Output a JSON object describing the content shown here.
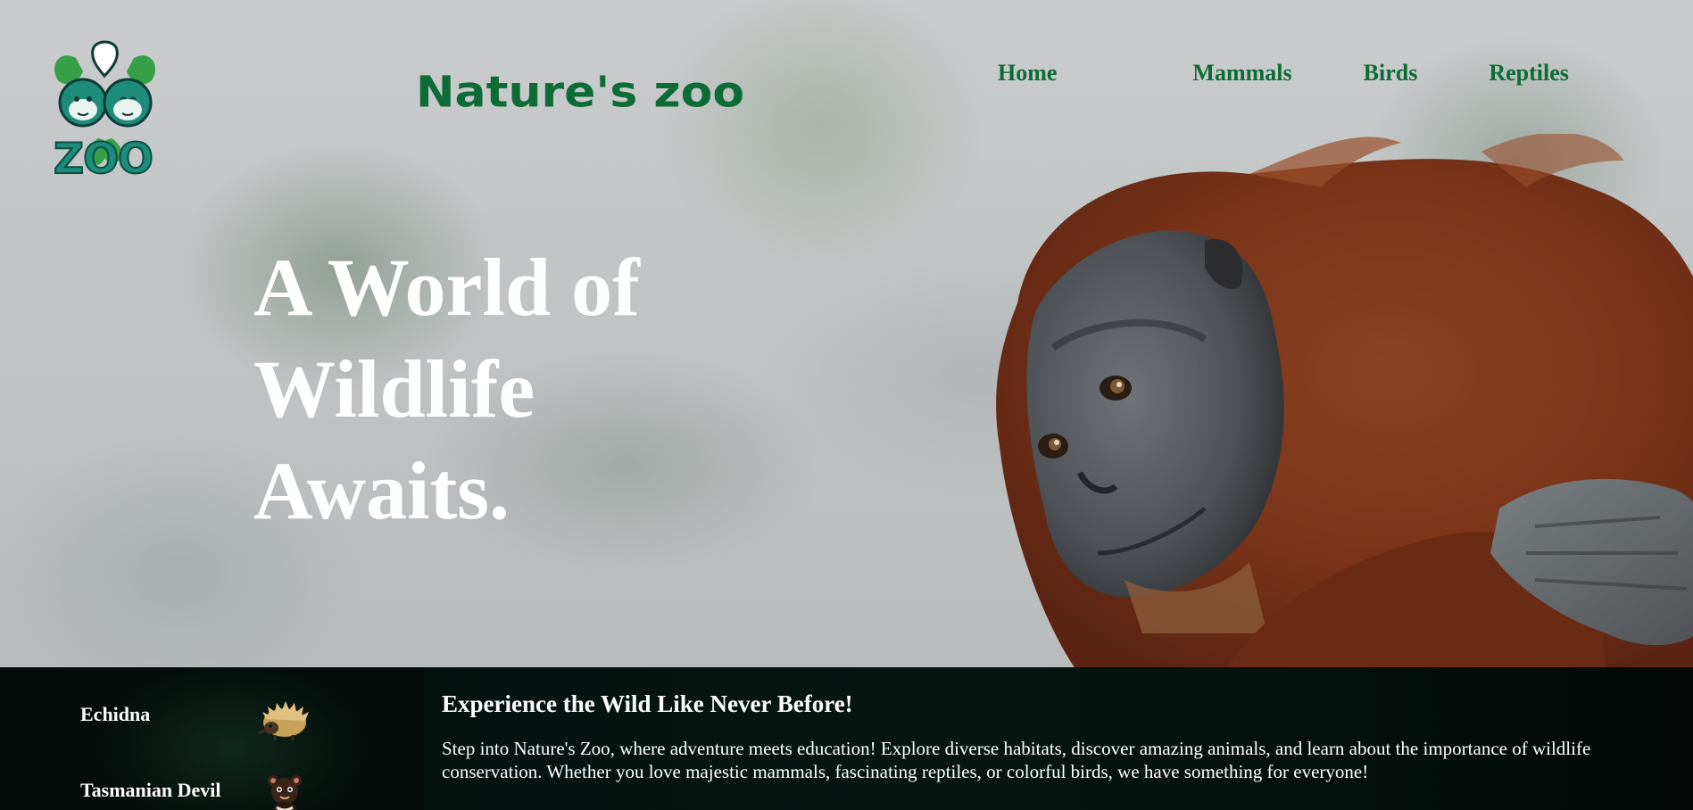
{
  "header": {
    "logo_text": "ZOO",
    "brand_title": "Nature's zoo",
    "nav": [
      {
        "label": "Home"
      },
      {
        "label": "Mammals"
      },
      {
        "label": "Birds"
      },
      {
        "label": "Reptiles"
      }
    ]
  },
  "hero": {
    "headline_line1": "A World of",
    "headline_line2": "Wildlife",
    "headline_line3": "Awaits.",
    "image_subject": "orangutan"
  },
  "sidebar": {
    "animals": [
      {
        "name": "Echidna",
        "icon": "echidna-icon"
      },
      {
        "name": "Tasmanian Devil",
        "icon": "tasmanian-devil-icon"
      }
    ]
  },
  "intro": {
    "heading": "Experience the Wild Like Never Before!",
    "body": "Step into Nature's Zoo, where adventure meets education! Explore diverse habitats, discover amazing animals, and learn about the importance of wildlife conservation. Whether you love majestic mammals, fascinating reptiles, or colorful birds, we have something for everyone!"
  },
  "colors": {
    "brand_green": "#0d6b35",
    "logo_teal": "#1d8c7a",
    "hero_text": "#ffffff",
    "strip_bg": "#050c09"
  }
}
